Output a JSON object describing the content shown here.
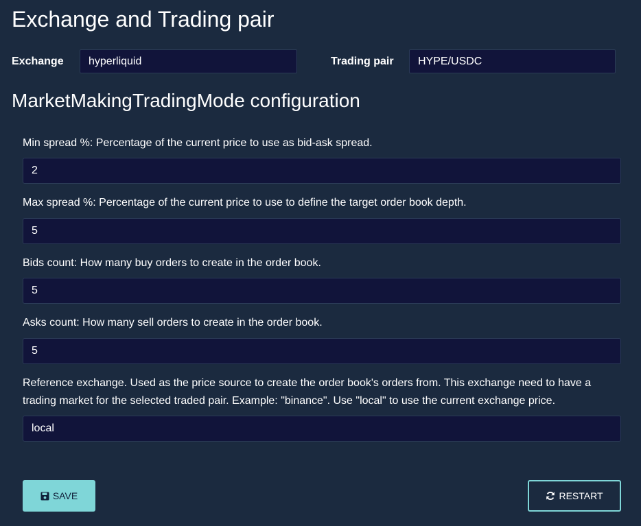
{
  "header": {
    "title": "Exchange and Trading pair"
  },
  "pair": {
    "exchange_label": "Exchange",
    "exchange_value": "hyperliquid",
    "trading_pair_label": "Trading pair",
    "trading_pair_value": "HYPE/USDC"
  },
  "config": {
    "title": "MarketMakingTradingMode configuration",
    "fields": [
      {
        "label": "Min spread %: Percentage of the current price to use as bid-ask spread.",
        "value": "2"
      },
      {
        "label": "Max spread %: Percentage of the current price to use to define the target order book depth.",
        "value": "5"
      },
      {
        "label": "Bids count: How many buy orders to create in the order book.",
        "value": "5"
      },
      {
        "label": "Asks count: How many sell orders to create in the order book.",
        "value": "5"
      },
      {
        "label": "Reference exchange. Used as the price source to create the order book's orders from. This exchange need to have a trading market for the selected traded pair. Example: \"binance\". Use \"local\" to use the current exchange price.",
        "value": "local"
      }
    ]
  },
  "actions": {
    "save_label": "SAVE",
    "save_icon": "floppy-disk-icon",
    "restart_label": "RESTART",
    "restart_icon": "refresh-icon"
  },
  "colors": {
    "background": "#1b2a3f",
    "input_background": "#11143a",
    "accent": "#7fd6d8"
  }
}
